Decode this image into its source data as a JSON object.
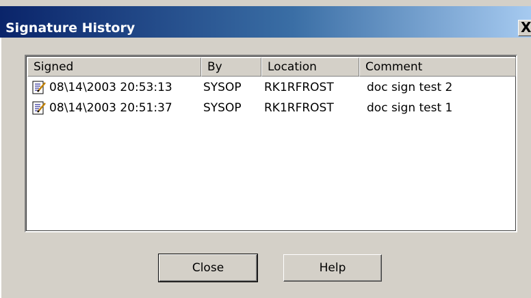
{
  "window": {
    "title": "Signature History"
  },
  "titlebar": {
    "close_glyph": "X"
  },
  "list": {
    "columns": [
      "Signed",
      "By",
      "Location",
      "Comment"
    ],
    "rows": [
      {
        "icon": "signed-document-icon",
        "signed": "08\\14\\2003 20:53:13",
        "by": "SYSOP",
        "location": "RK1RFROST",
        "comment": "doc sign test 2"
      },
      {
        "icon": "signed-document-icon",
        "signed": "08\\14\\2003 20:51:37",
        "by": "SYSOP",
        "location": "RK1RFROST",
        "comment": "doc sign test 1"
      }
    ]
  },
  "buttons": {
    "close_label": "Close",
    "help_label": "Help"
  }
}
